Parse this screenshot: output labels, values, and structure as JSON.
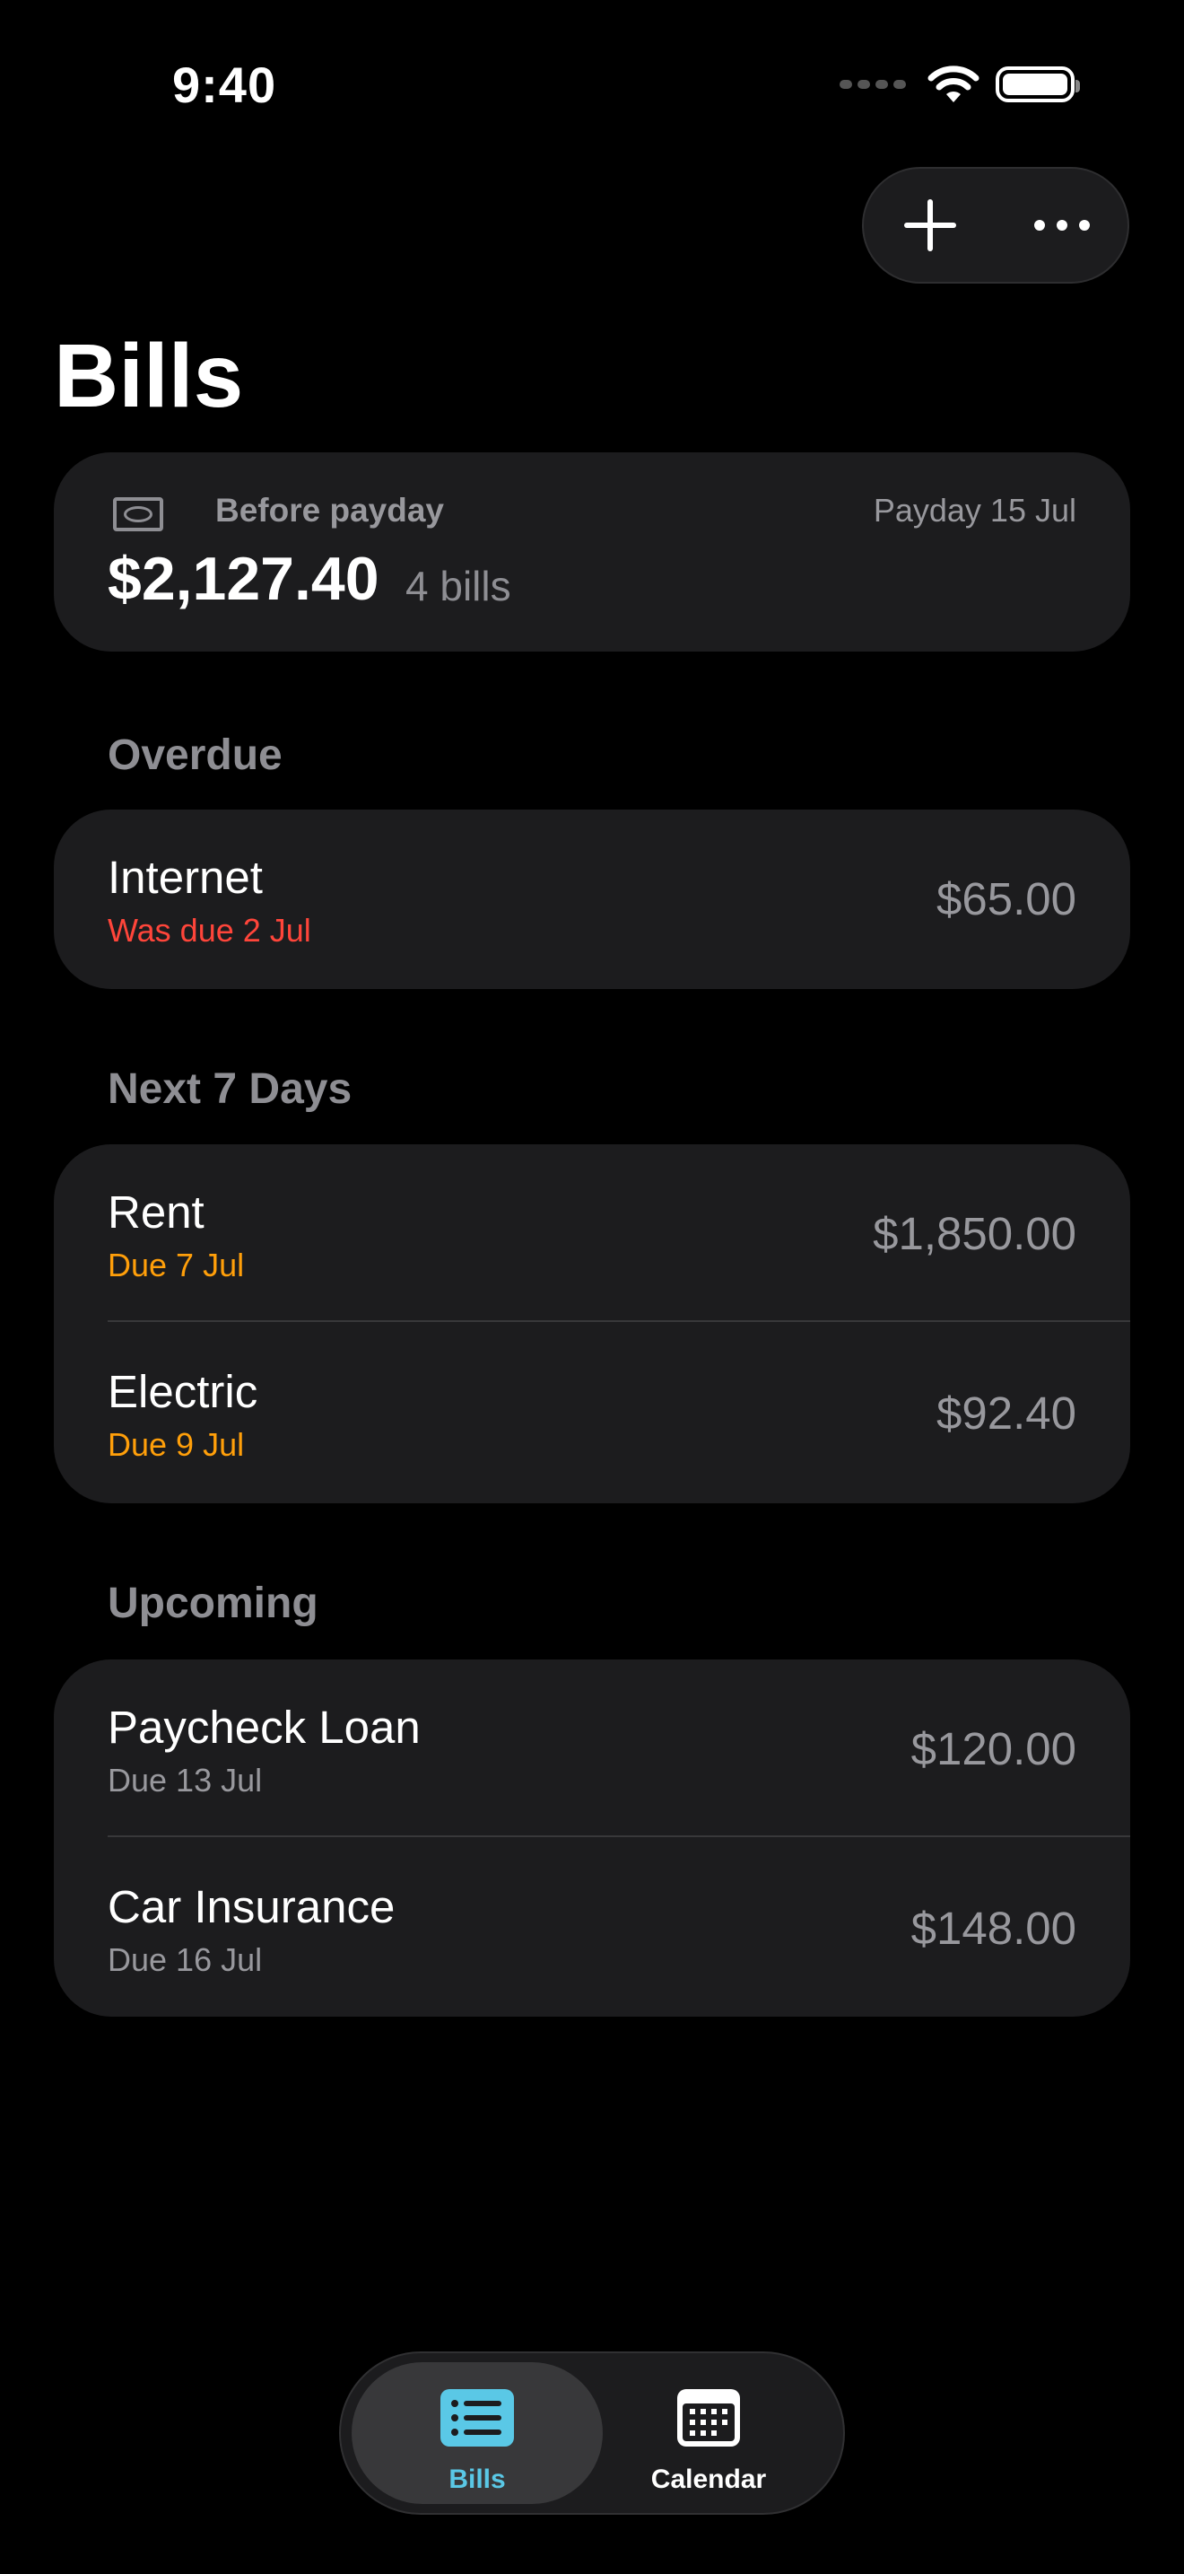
{
  "status_bar": {
    "time": "9:40"
  },
  "page": {
    "title": "Bills"
  },
  "summary": {
    "label": "Before payday",
    "payday": "Payday 15 Jul",
    "total": "$2,127.40",
    "count": "4 bills"
  },
  "sections": [
    {
      "title": "Overdue",
      "items": [
        {
          "name": "Internet",
          "due": "Was due 2 Jul",
          "amount": "$65.00"
        }
      ]
    },
    {
      "title": "Next 7 Days",
      "items": [
        {
          "name": "Rent",
          "due": "Due 7 Jul",
          "amount": "$1,850.00"
        },
        {
          "name": "Electric",
          "due": "Due 9 Jul",
          "amount": "$92.40"
        }
      ]
    },
    {
      "title": "Upcoming",
      "items": [
        {
          "name": "Paycheck Loan",
          "due": "Due 13 Jul",
          "amount": "$120.00"
        },
        {
          "name": "Car Insurance",
          "due": "Due 16 Jul",
          "amount": "$148.00"
        }
      ]
    }
  ],
  "tabs": [
    {
      "label": "Bills",
      "icon": "list-icon"
    },
    {
      "label": "Calendar",
      "icon": "calendar-icon"
    }
  ],
  "colors": {
    "overdue": "#ff453a",
    "soon": "#ff9f0a",
    "upcoming": "#98989d",
    "accent": "#5ac8e6",
    "card": "#1c1c1e"
  }
}
